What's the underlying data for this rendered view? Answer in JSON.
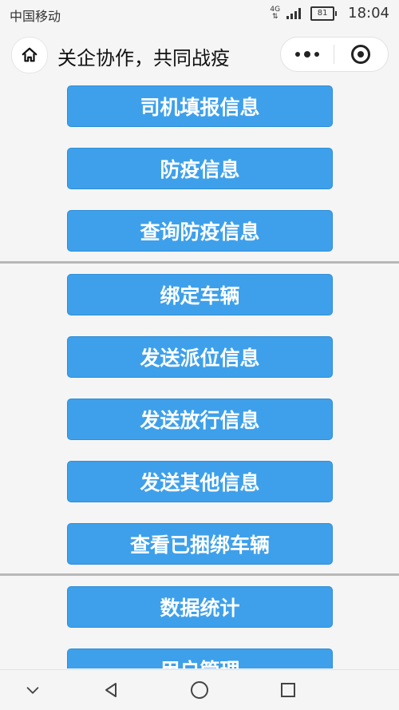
{
  "status_bar": {
    "carrier": "中国移动",
    "network": "4G",
    "battery": "81",
    "time": "18:04"
  },
  "header": {
    "title": "关企协作，共同战疫"
  },
  "menu": {
    "items": [
      {
        "label": "司机填报信息"
      },
      {
        "label": "防疫信息"
      },
      {
        "label": "查询防疫信息"
      },
      {
        "label": "绑定车辆"
      },
      {
        "label": "发送派位信息"
      },
      {
        "label": "发送放行信息"
      },
      {
        "label": "发送其他信息"
      },
      {
        "label": "查看已捆绑车辆"
      },
      {
        "label": "数据统计"
      },
      {
        "label": "用户管理"
      }
    ]
  },
  "colors": {
    "button_bg": "#3ea0ea",
    "divider": "#b8b8b8"
  },
  "icons": {
    "home": "home-icon",
    "more": "more-icon",
    "close": "target-icon",
    "nav_down": "chevron-down-icon",
    "nav_back": "back-triangle-icon",
    "nav_home": "home-circle-icon",
    "nav_recent": "recent-square-icon"
  }
}
